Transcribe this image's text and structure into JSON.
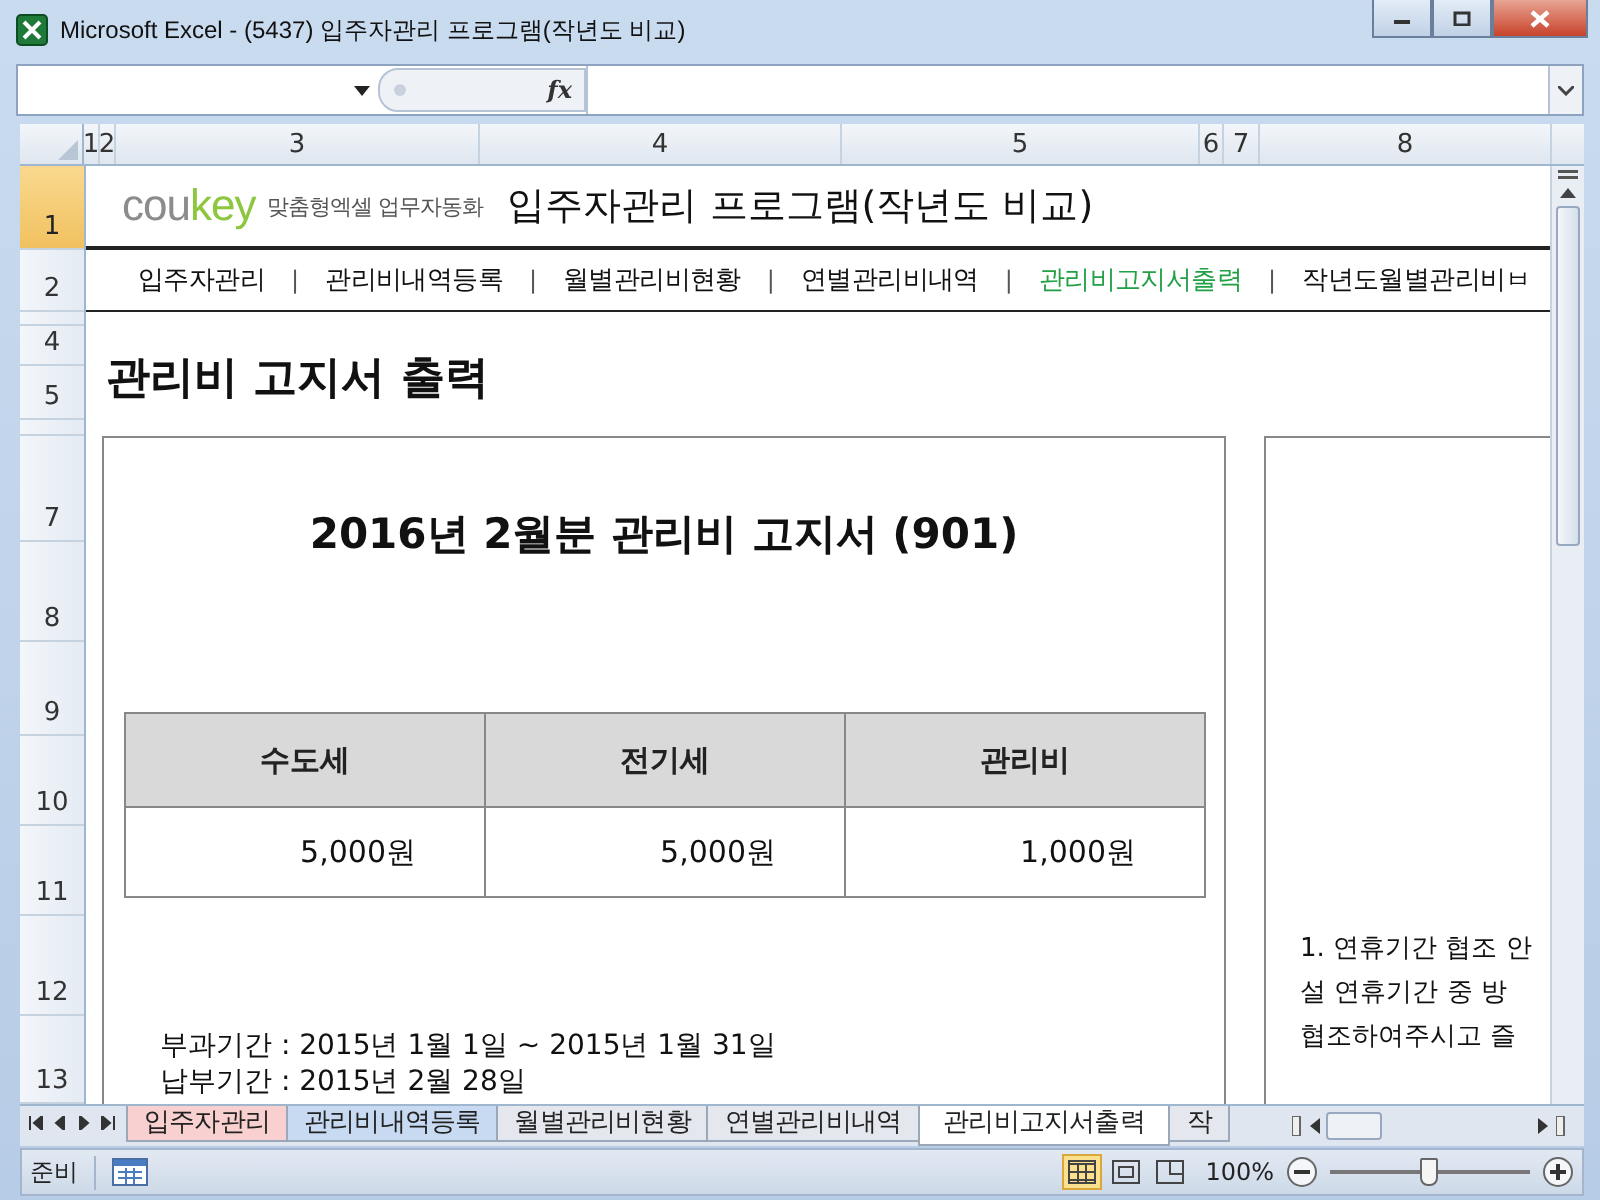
{
  "window": {
    "title": "Microsoft Excel - (5437) 입주자관리 프로그램(작년도 비교)"
  },
  "formula_bar": {
    "fx": "fx"
  },
  "columns": [
    {
      "label": "1"
    },
    {
      "label": "2"
    },
    {
      "label": "3"
    },
    {
      "label": "4"
    },
    {
      "label": "5"
    },
    {
      "label": "6"
    },
    {
      "label": "7"
    },
    {
      "label": "8"
    }
  ],
  "rows": [
    {
      "kind": "normal",
      "label": "1",
      "selected": true
    },
    {
      "kind": "normal",
      "label": "2",
      "selected": false
    },
    {
      "kind": "collapsed",
      "selected": false
    },
    {
      "kind": "normal",
      "label": "4",
      "selected": false
    },
    {
      "kind": "normal",
      "label": "5",
      "selected": false
    },
    {
      "kind": "collapsed",
      "selected": false
    },
    {
      "kind": "normal",
      "label": "7",
      "selected": false
    },
    {
      "kind": "normal",
      "label": "8",
      "selected": false
    },
    {
      "kind": "normal",
      "label": "9",
      "selected": false
    },
    {
      "kind": "normal",
      "label": "10",
      "selected": false
    },
    {
      "kind": "normal",
      "label": "11",
      "selected": false
    },
    {
      "kind": "normal",
      "label": "12",
      "selected": false
    },
    {
      "kind": "normal",
      "label": "13",
      "selected": false
    }
  ],
  "header": {
    "logo_grey": "cou",
    "logo_green": "key",
    "tagline": "맞춤형엑셀 업무자동화",
    "title": "입주자관리 프로그램(작년도 비교)"
  },
  "nav": [
    {
      "label": "입주자관리",
      "selected": false
    },
    {
      "label": "관리비내역등록",
      "selected": false
    },
    {
      "label": "월별관리비현황",
      "selected": false
    },
    {
      "label": "연별관리비내역",
      "selected": false
    },
    {
      "label": "관리비고지서출력",
      "selected": true
    },
    {
      "label": "작년도월별관리비ㅂ",
      "selected": false
    }
  ],
  "nav_separator": "|",
  "page_heading": "관리비 고지서 출력",
  "notice": {
    "title": "2016년 2월분 관리비 고지서 (901)",
    "table": {
      "columns": [
        "수도세",
        "전기세",
        "관리비"
      ],
      "values": [
        "5,000원",
        "5,000원",
        "1,000원"
      ]
    },
    "lines": [
      "부과기간 : 2015년 1월 1일 ~ 2015년 1월 31일",
      "납부기간 : 2015년 2월 28일"
    ]
  },
  "side_note": {
    "lines": [
      "1. 연휴기간 협조 안",
      "설 연휴기간 중 방",
      "협조하여주시고 즐"
    ]
  },
  "sheet_tabs": [
    {
      "label": "입주자관리",
      "color": "#f8d0d0",
      "selected": false
    },
    {
      "label": "관리비내역등록",
      "color": "#c8daf2",
      "selected": false
    },
    {
      "label": "월별관리비현황",
      "color": "#e4e8ee",
      "selected": false
    },
    {
      "label": "연별관리비내역",
      "color": "#e4e8ee",
      "selected": false
    },
    {
      "label": "관리비고지서출력",
      "color": "#ffffff",
      "selected": true
    },
    {
      "label": "작",
      "color": "#e4e8ee",
      "selected": false
    }
  ],
  "status": {
    "text": "준비",
    "zoom": "100%",
    "zoom_slider": {
      "level": 0.5
    },
    "views": [
      {
        "kind": "normal",
        "selected": true
      },
      {
        "kind": "layout",
        "selected": false
      },
      {
        "kind": "pagebreak",
        "selected": false
      }
    ]
  }
}
